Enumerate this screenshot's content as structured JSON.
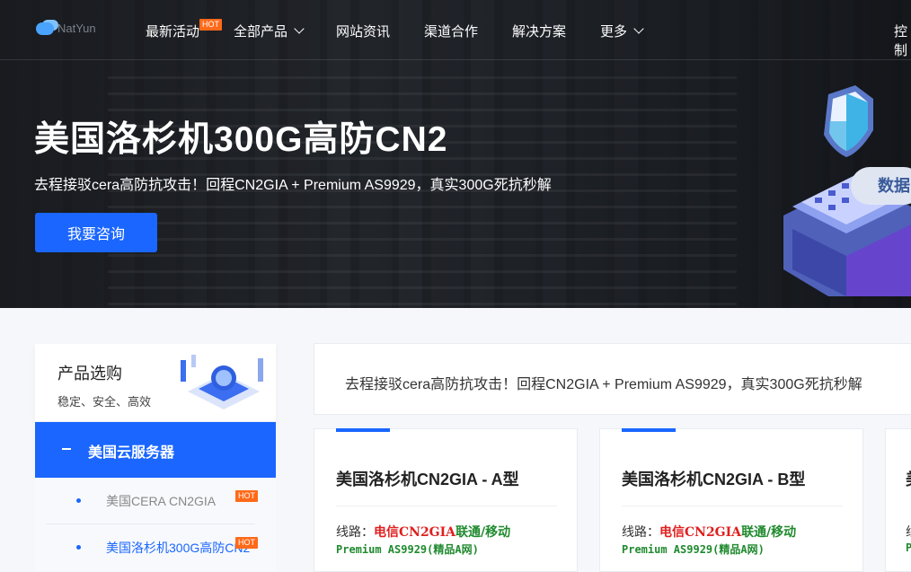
{
  "nav": {
    "logo_text": "NatYun",
    "items": [
      {
        "label": "最新活动",
        "badge": "HOT"
      },
      {
        "label": "全部产品"
      },
      {
        "label": "网站资讯"
      },
      {
        "label": "渠道合作"
      },
      {
        "label": "解决方案"
      },
      {
        "label": "更多"
      }
    ],
    "console": "控制"
  },
  "hero": {
    "title": "美国洛杉机300G高防CN2",
    "subtitle": "去程接驳cera高防抗攻击！回程CN2GIA + Premium AS9929，真实300G死抗秒解",
    "cta": "我要咨询",
    "badge_text": "数据"
  },
  "sidebar": {
    "title": "产品选购",
    "slogan": "稳定、安全、高效",
    "category": "美国云服务器",
    "items": [
      {
        "label": "美国CERA CN2GIA",
        "badge": "HOT",
        "active": false
      },
      {
        "label": "美国洛杉机300G高防CN2",
        "badge": "HOT",
        "active": true
      }
    ]
  },
  "main": {
    "banner_text": "去程接驳cera高防抗攻击！回程CN2GIA + Premium AS9929，真实300G死抗秒解",
    "cards": [
      {
        "title": "美国洛杉机CN2GIA - A型",
        "route_label": "线路：",
        "route_telecom": "电信CN2GIA",
        "route_other": "联通/移动",
        "premium": "Premium AS9929(精品A网)"
      },
      {
        "title": "美国洛杉机CN2GIA - B型",
        "route_label": "线路：",
        "route_telecom": "电信CN2GIA",
        "route_other": "联通/移动",
        "premium": "Premium AS9929(精品A网)"
      },
      {
        "title": "美",
        "route_label": "线",
        "route_telecom": "",
        "route_other": "",
        "premium": "P"
      }
    ]
  },
  "colors": {
    "accent": "#1a66ff",
    "hot": "#ff6a1a",
    "telecom": "#e02020",
    "green": "#1f8a2e"
  }
}
